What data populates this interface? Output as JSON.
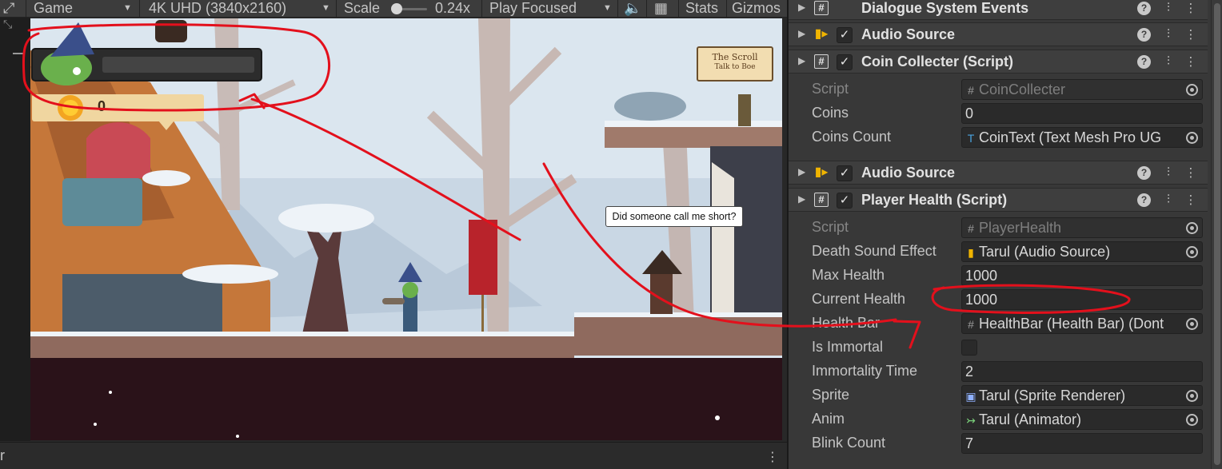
{
  "game_view": {
    "tab_label": "Game",
    "resolution": "4K UHD (3840x2160)",
    "scale_label": "Scale",
    "scale_value": "0.24x",
    "play_mode": "Play Focused",
    "stats_label": "Stats",
    "gizmos_label": "Gizmos",
    "status_text": "r",
    "scene": {
      "speech_bubble": "Did someone call me short?",
      "sign_title": "The Scroll",
      "sign_subtitle": "Talk to Boe",
      "coin_count": "0"
    }
  },
  "inspector": {
    "rows": [
      {
        "kind": "header",
        "icon": "script",
        "checkbox": false,
        "title": "Dialogue System Events"
      },
      {
        "kind": "header",
        "icon": "audio",
        "checkbox": true,
        "title": "Audio Source"
      },
      {
        "kind": "header",
        "icon": "script",
        "checkbox": true,
        "title": "Coin Collecter (Script)"
      },
      {
        "kind": "prop",
        "label": "Script",
        "value": "CoinCollecter",
        "value_icon": "script-icon",
        "picker": true,
        "disabled": true
      },
      {
        "kind": "prop",
        "label": "Coins",
        "value": "0",
        "picker": false
      },
      {
        "kind": "prop",
        "label": "Coins Count",
        "value": "CoinText (Text Mesh Pro UG",
        "value_icon": "textmeshpro-icon",
        "picker": true
      },
      {
        "kind": "header",
        "icon": "audio",
        "checkbox": true,
        "title": "Audio Source"
      },
      {
        "kind": "header",
        "icon": "script",
        "checkbox": true,
        "title": "Player Health (Script)"
      },
      {
        "kind": "prop",
        "label": "Script",
        "value": "PlayerHealth",
        "value_icon": "script-icon",
        "picker": true,
        "disabled": true
      },
      {
        "kind": "prop",
        "label": "Death Sound Effect",
        "value": "Tarul (Audio Source)",
        "value_icon": "audio-source-icon",
        "picker": true
      },
      {
        "kind": "prop",
        "label": "Max Health",
        "value": "1000",
        "picker": false
      },
      {
        "kind": "prop",
        "label": "Current Health",
        "value": "1000",
        "picker": false
      },
      {
        "kind": "prop",
        "label": "Health Bar",
        "value": "HealthBar (Health Bar) (Dont",
        "value_icon": "script-icon",
        "picker": true
      },
      {
        "kind": "prop",
        "label": "Is Immortal",
        "value": "",
        "checkbox": true,
        "checked": false
      },
      {
        "kind": "prop",
        "label": "Immortality Time",
        "value": "2",
        "picker": false
      },
      {
        "kind": "prop",
        "label": "Sprite",
        "value": "Tarul (Sprite Renderer)",
        "value_icon": "sprite-renderer-icon",
        "picker": true
      },
      {
        "kind": "prop",
        "label": "Anim",
        "value": "Tarul (Animator)",
        "value_icon": "animator-icon",
        "picker": true
      },
      {
        "kind": "prop",
        "label": "Blink Count",
        "value": "7",
        "picker": false
      }
    ]
  },
  "icons": {
    "maximize": "maximize-icon",
    "audio_mute": "speaker-icon",
    "stats_grid": "grid-icon",
    "help": "help-icon",
    "preset": "preset-sliders-icon",
    "menu": "kebab-menu-icon",
    "picker": "object-picker-icon"
  },
  "colors": {
    "annotation": "#e3101c",
    "unity_dark": "#383838",
    "header_bg": "#3e3e3e",
    "sky": "#dbe6ef",
    "ground": "#2a1219"
  }
}
